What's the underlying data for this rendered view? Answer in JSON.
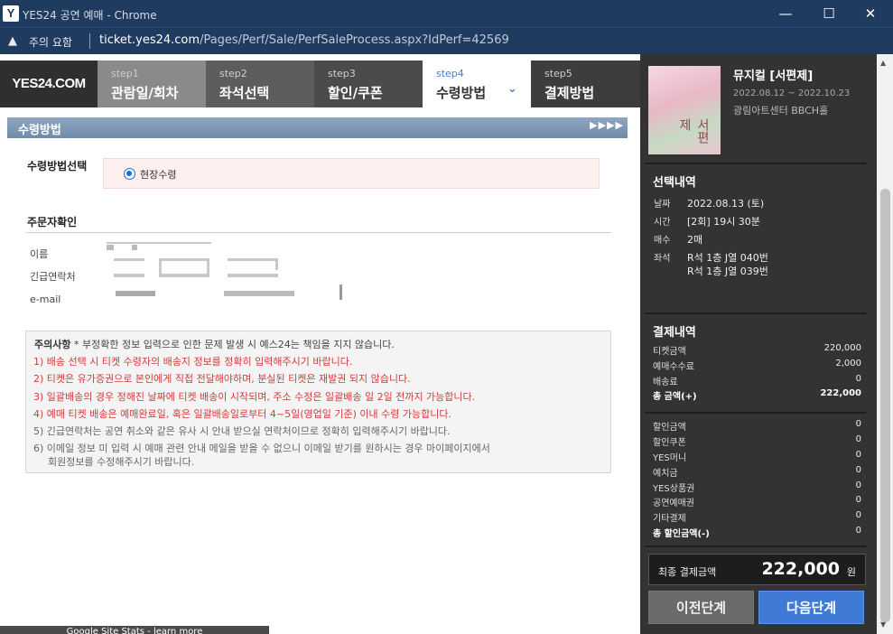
{
  "window": {
    "app_icon": "Y",
    "title": "YES24 공연 예매 - Chrome",
    "min": "—",
    "max": "☐",
    "close": "✕"
  },
  "urlbar": {
    "warn_icon": "▲",
    "warning": "주의 요함",
    "host": "ticket.yes24.com",
    "path": "/Pages/Perf/Sale/PerfSaleProcess.aspx?IdPerf=42569"
  },
  "logo": "YES24.COM",
  "steps": [
    {
      "num": "step1",
      "label": "관람일/회차"
    },
    {
      "num": "step2",
      "label": "좌석선택"
    },
    {
      "num": "step3",
      "label": "할인/쿠폰"
    },
    {
      "num": "step4",
      "label": "수령방법",
      "chevron": "⌄"
    },
    {
      "num": "step5",
      "label": "결제방법"
    }
  ],
  "section": {
    "title": "수령방법",
    "arrows": "▶▶▶▶"
  },
  "method": {
    "heading": "수령방법선택",
    "option": "현장수령"
  },
  "orderer": {
    "heading": "주문자확인",
    "name_label": "이름",
    "phone_label": "긴급연락처",
    "email_label": "e-mail"
  },
  "notice": {
    "title": "주의사항",
    "title_rest": " * 부정확한 정보 입력으로 인한 문제 발생 시 예스24는 책임을 지지 않습니다.",
    "lines": [
      "1) 배송 선택 시 티켓 수령자의 배송지 정보를 정확히 입력해주시기 바랍니다.",
      "2) 티켓은 유가증권으로 본인에게 직접 전달해야하며, 분실된 티켓은 재발권 되지 않습니다.",
      "3) 일괄배송의 경우 정해진 날짜에 티켓 배송이 시작되며, 주소 수정은 일괄배송 일 2일 전까지 가능합니다.",
      "4) 예매 티켓 배송은 예매완료일, 혹은 일괄배송일로부터 4~5일(영업일 기준) 이내 수령 가능합니다.",
      "5) 긴급연락처는 공연 취소와 같은 유사 시 안내 받으실 연락처이므로 정확히 입력해주시기 바랍니다.",
      "6) 이메일 정보 미 입력 시 예매 관련 안내 메일을 받을 수 없으니 이메일 받기를 원하시는 경우 마이페이지에서",
      "회원정보를 수정해주시기 바랍니다."
    ]
  },
  "show": {
    "title": "뮤지컬 [서편제]",
    "poster_text": "서편제",
    "dates": "2022.08.12 ~ 2022.10.23",
    "venue": "광림아트센터 BBCH홀"
  },
  "selection": {
    "heading": "선택내역",
    "date_k": "날짜",
    "date_v": "2022.08.13 (토)",
    "time_k": "시간",
    "time_v": "[2회] 19시 30분",
    "count_k": "매수",
    "count_v": "2매",
    "seat_k": "좌석",
    "seat_v1": "R석 1층 J열 040번",
    "seat_v2": "R석 1층 J열 039번"
  },
  "payment": {
    "heading": "결제내역",
    "rows": [
      {
        "k": "티켓금액",
        "v": "220,000"
      },
      {
        "k": "예매수수료",
        "v": "2,000"
      },
      {
        "k": "배송료",
        "v": "0"
      },
      {
        "k": "총 금액(+)",
        "v": "222,000"
      }
    ],
    "discounts": [
      {
        "k": "할인금액",
        "v": "0"
      },
      {
        "k": "할인쿠폰",
        "v": "0"
      },
      {
        "k": "YES머니",
        "v": "0"
      },
      {
        "k": "예치금",
        "v": "0"
      },
      {
        "k": "YES상품권",
        "v": "0"
      },
      {
        "k": "공연예매권",
        "v": "0"
      },
      {
        "k": "기타결제",
        "v": "0"
      },
      {
        "k": "총 할인금액(-)",
        "v": "0"
      }
    ],
    "final_k": "최종 결제금액",
    "final_v": "222,000",
    "final_unit": "원"
  },
  "buttons": {
    "prev": "이전단계",
    "next": "다음단계"
  },
  "scroll": {
    "up": "▲",
    "down": "▼"
  },
  "status": "Google Site Stats - learn more"
}
